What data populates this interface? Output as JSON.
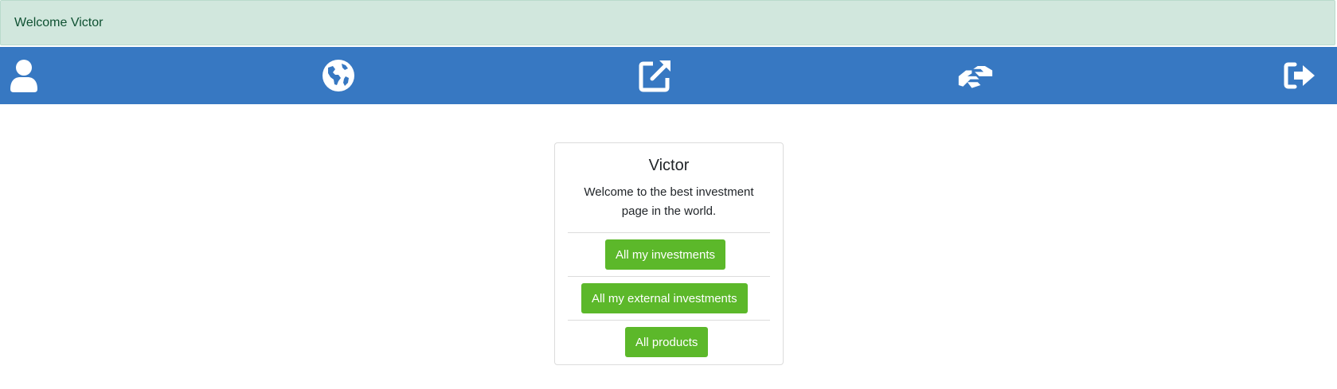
{
  "alert": {
    "text": "Welcome Victor"
  },
  "nav": {
    "color": "#3778c2",
    "icons": [
      "user-icon",
      "globe-icon",
      "external-link-icon",
      "handshake-icon",
      "sign-out-icon"
    ]
  },
  "card": {
    "title": "Victor",
    "text": "Welcome to the best investment page in the world.",
    "buttons": {
      "investments": "All my investments",
      "external_investments": "All my external investments",
      "products": "All products"
    },
    "button_color": "#5cb82a"
  }
}
